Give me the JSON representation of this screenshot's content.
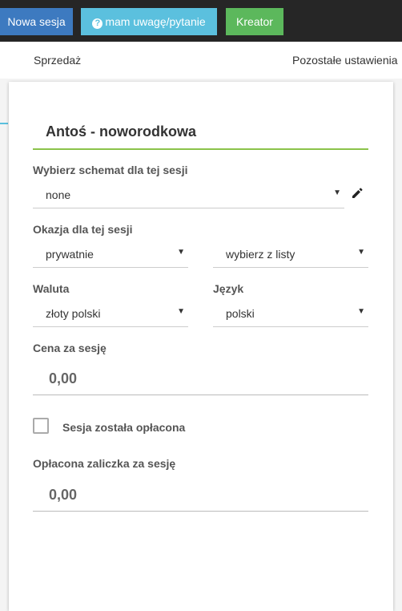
{
  "topbar": {
    "new_session": "Nowa sesja",
    "note_question": "mam uwagę/pytanie",
    "kreator": "Kreator"
  },
  "tabs": {
    "sales": "Sprzedaż",
    "other_settings": "Pozostałe ustawienia"
  },
  "form": {
    "title": "Antoś - noworodkowa",
    "schema_label": "Wybierz schemat dla tej sesji",
    "schema_value": "none",
    "occasion_label": "Okazja dla tej sesji",
    "occasion_value": "prywatnie",
    "occasion_list_value": "wybierz z listy",
    "currency_label": "Waluta",
    "currency_value": "złoty polski",
    "language_label": "Język",
    "language_value": "polski",
    "price_label": "Cena za sesję",
    "price_value": "0,00",
    "paid_label": "Sesja została opłacona",
    "paid_checked": false,
    "deposit_label": "Opłacona zaliczka za sesję",
    "deposit_value": "0,00"
  },
  "colors": {
    "topbar": "#262626",
    "new_session_btn": "#3d7ac0",
    "note_btn": "#5bc0de",
    "kreator_btn": "#5cb85c",
    "title_underline": "#8bc34a"
  },
  "icons": {
    "note": "question-circle-icon",
    "edit": "pencil-icon",
    "dropdown": "caret-down-icon"
  }
}
